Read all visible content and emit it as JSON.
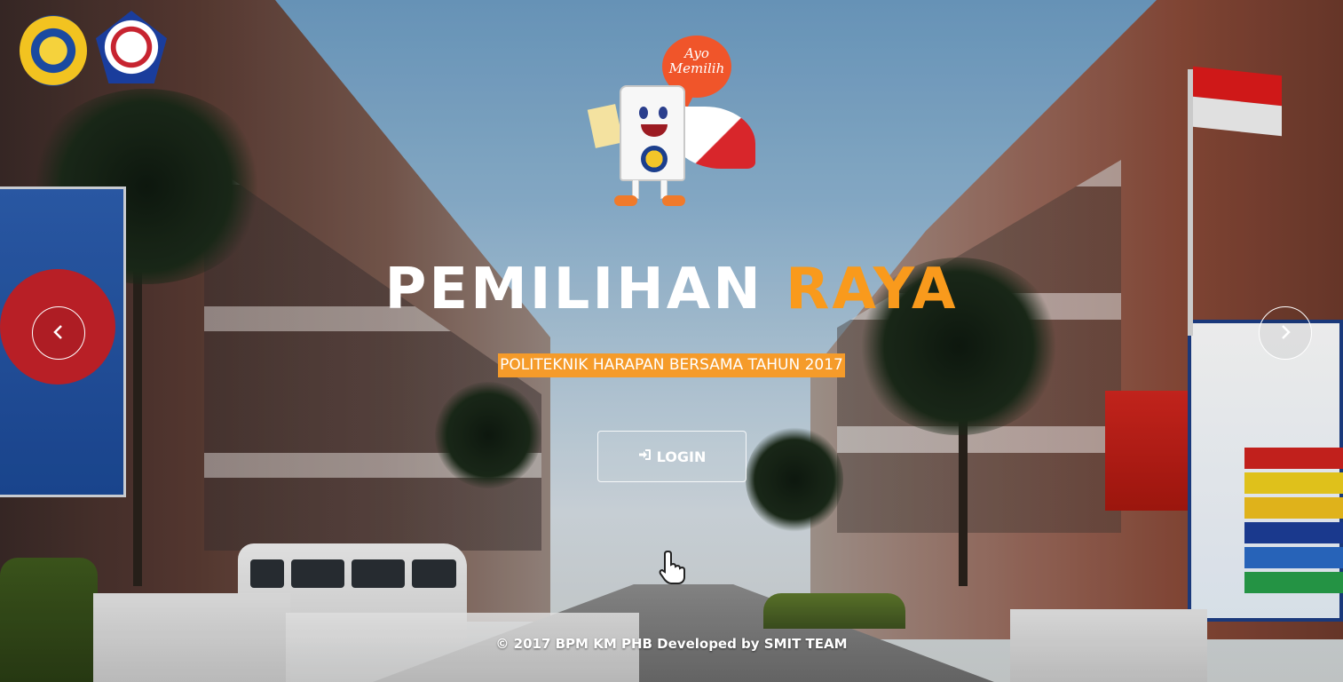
{
  "hero": {
    "title_main": "PEMILIHAN",
    "title_accent": "RAYA",
    "subtitle": "POLITEKNIK HARAPAN BERSAMA TAHUN 2017"
  },
  "mascot": {
    "bubble_text": "Ayo\nMemilih"
  },
  "login": {
    "icon": "sign-in-icon",
    "label": "LOGIN"
  },
  "carousel": {
    "prev_icon": "chevron-left-icon",
    "next_icon": "chevron-right-icon"
  },
  "footer": {
    "text": "© 2017 BPM KM PHB Developed by SMIT TEAM"
  },
  "colors": {
    "accent": "#f99a1c",
    "subtitle_bg": "#f59b2a",
    "text": "#ffffff"
  }
}
